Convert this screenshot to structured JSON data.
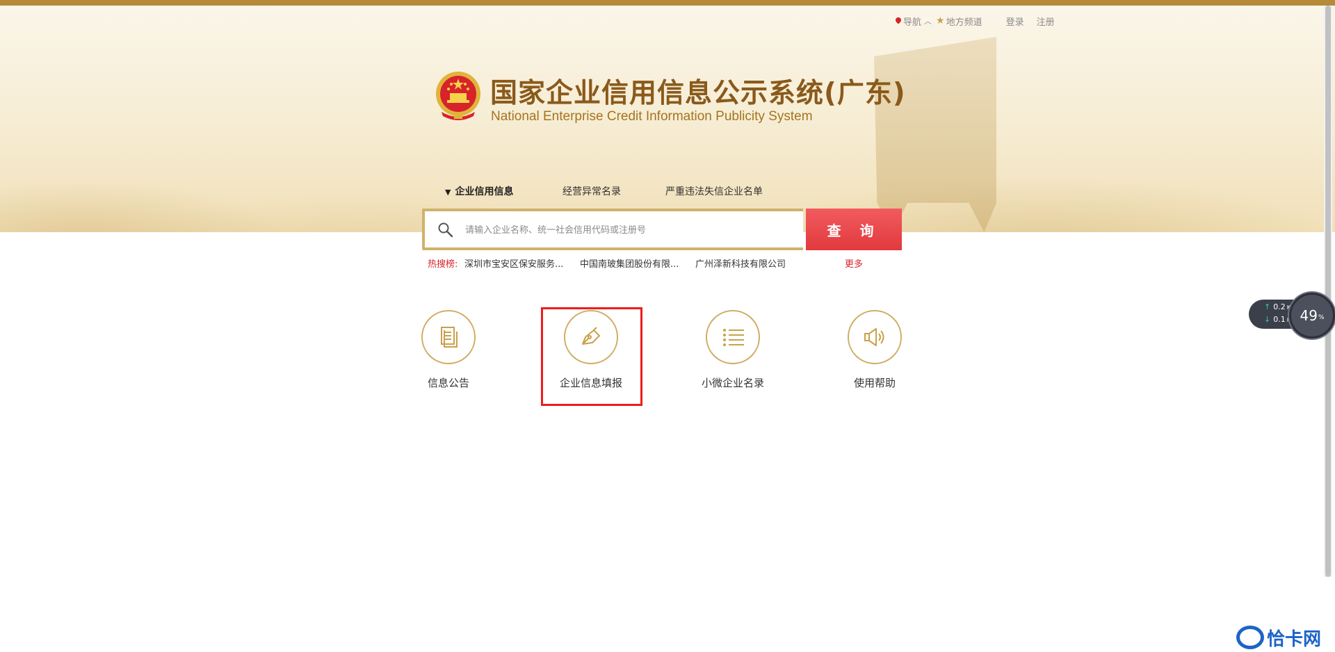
{
  "top_nav": {
    "nav_label": "导航",
    "local_channel": "地方频道",
    "login": "登录",
    "register": "注册"
  },
  "logo": {
    "title": "国家企业信用信息公示系统(广东)",
    "subtitle": "National Enterprise Credit Information Publicity System"
  },
  "tabs": [
    {
      "label": "企业信用信息",
      "active": true
    },
    {
      "label": "经营异常名录",
      "active": false
    },
    {
      "label": "严重违法失信企业名单",
      "active": false
    }
  ],
  "search": {
    "placeholder": "请输入企业名称、统一社会信用代码或注册号",
    "button_label": "查  询"
  },
  "hot_search": {
    "label": "热搜榜:",
    "items": [
      "深圳市宝安区保安服务...",
      "中国南玻集团股份有限...",
      "广州泽新科技有限公司"
    ],
    "more": "更多"
  },
  "features": [
    {
      "label": "信息公告",
      "icon": "document-icon"
    },
    {
      "label": "企业信息填报",
      "icon": "pen-icon",
      "highlighted": true
    },
    {
      "label": "小微企业名录",
      "icon": "list-icon"
    },
    {
      "label": "使用帮助",
      "icon": "speaker-icon"
    }
  ],
  "speed_widget": {
    "upload": "0.2",
    "download": "0.1",
    "unit": "K/s",
    "percent": "49",
    "percent_unit": "%"
  },
  "watermark": {
    "text": "恰卡网"
  },
  "colors": {
    "accent_gold": "#b58a3a",
    "search_red": "#e23a3d",
    "highlight_red": "#ef1c1c",
    "hot_red": "#d8232a"
  }
}
